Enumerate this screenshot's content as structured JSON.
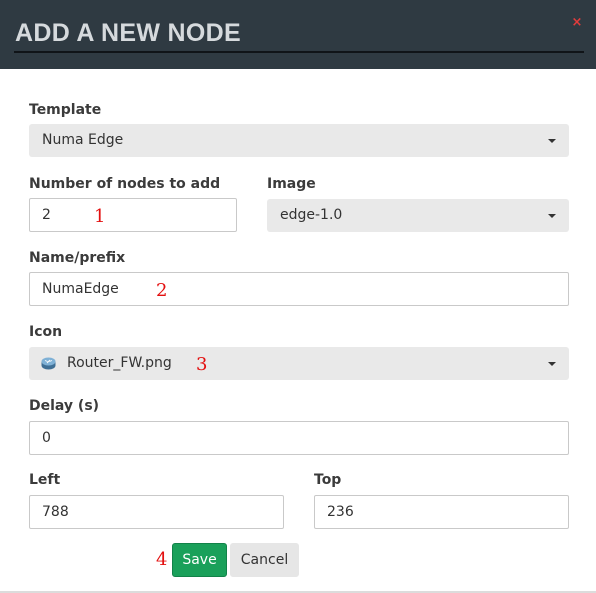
{
  "header": {
    "title": "ADD A NEW NODE",
    "close_glyph": "×"
  },
  "form": {
    "template": {
      "label": "Template",
      "value": "Numa Edge"
    },
    "count": {
      "label": "Number of nodes to add",
      "value": "2",
      "marker": "1"
    },
    "image": {
      "label": "Image",
      "value": "edge-1.0"
    },
    "name": {
      "label": "Name/prefix",
      "value": "NumaEdge",
      "marker": "2"
    },
    "icon": {
      "label": "Icon",
      "value": "Router_FW.png",
      "icon_name": "router-icon",
      "marker": "3"
    },
    "delay": {
      "label": "Delay (s)",
      "value": "0"
    },
    "left": {
      "label": "Left",
      "value": "788"
    },
    "top": {
      "label": "Top",
      "value": "236"
    }
  },
  "footer": {
    "save_label": "Save",
    "cancel_label": "Cancel",
    "marker": "4"
  },
  "colors": {
    "header_bg": "#2f3a42",
    "save_bg": "#1aa05a",
    "marker": "#e30f0f"
  }
}
